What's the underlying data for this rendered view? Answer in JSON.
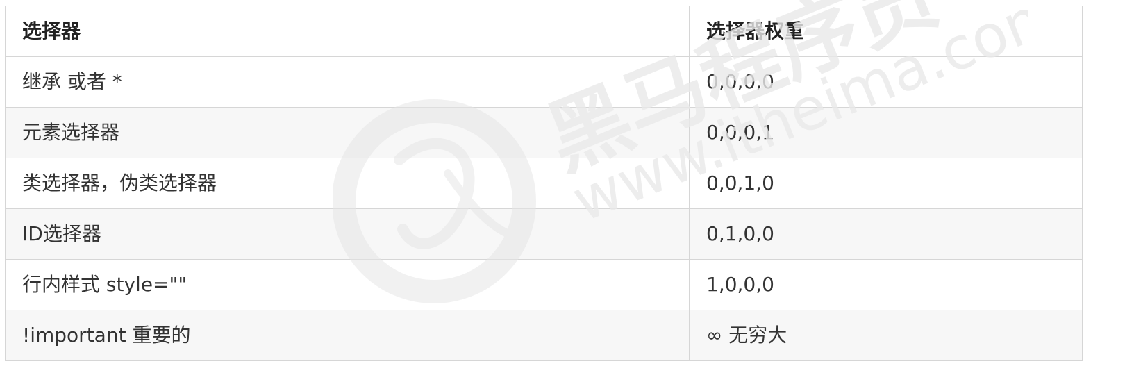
{
  "table": {
    "headers": [
      "选择器",
      "选择器权重"
    ],
    "rows": [
      [
        "继承 或者 *",
        "0,0,0,0"
      ],
      [
        "元素选择器",
        "0,0,0,1"
      ],
      [
        "类选择器，伪类选择器",
        "0,0,1,0"
      ],
      [
        "ID选择器",
        "0,1,0,0"
      ],
      [
        "行内样式 style=\"\"",
        "1,0,0,0"
      ],
      [
        "!important  重要的",
        "∞ 无穷大"
      ]
    ]
  },
  "watermark": {
    "brand_text": "黑马程序员",
    "url_text": "www.itheima.com",
    "icon": "itheima-logo-icon"
  },
  "colors": {
    "border": "#d6d6d6",
    "row_alt": "#f7f7f7",
    "text": "#333333",
    "watermark": "#e9e9e9"
  }
}
